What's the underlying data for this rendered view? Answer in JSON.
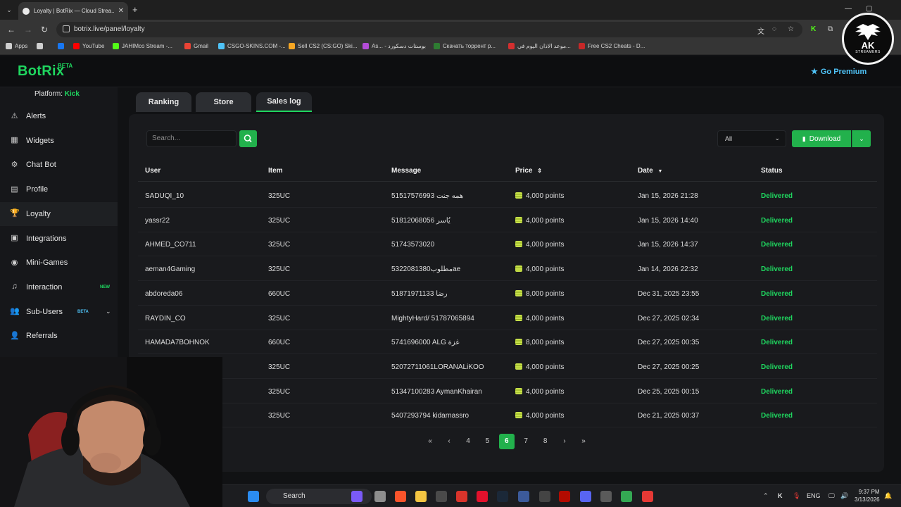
{
  "browser": {
    "tab_title": "Loyalty | BotRix — Cloud Strea...",
    "url": "botrix.live/panel/loyalty",
    "bookmarks": [
      {
        "label": "Apps",
        "color": "#cfcfcf"
      },
      {
        "label": "",
        "color": "#cfcfcf"
      },
      {
        "label": "",
        "color": "#1877f2"
      },
      {
        "label": "YouTube",
        "color": "#ff0000"
      },
      {
        "label": "JAHIMco Stream -...",
        "color": "#53fc18"
      },
      {
        "label": "Gmail",
        "color": "#ea4335"
      },
      {
        "label": "CSGO-SKINS.COM -...",
        "color": "#4fc3f7"
      },
      {
        "label": "Sell CS2 (CS:GO) Ski...",
        "color": "#f5a623"
      },
      {
        "label": "As... - بوستات دسكورد",
        "color": "#b44cd8"
      },
      {
        "label": "Скачать торрент р...",
        "color": "#2e7d32"
      },
      {
        "label": "موعد الاذان اليوم في...",
        "color": "#d32f2f"
      },
      {
        "label": "Free CS2 Cheats - D...",
        "color": "#c62828"
      }
    ]
  },
  "app": {
    "logo": "BotRix",
    "logo_badge": "BETA",
    "premium_label": "Go Premium"
  },
  "badge": {
    "title": "AK",
    "subtitle": "STREAMERS"
  },
  "sidebar": {
    "platform_label": "Platform:",
    "platform_value": "Kick",
    "items": [
      {
        "label": "Alerts",
        "icon": "⚠",
        "tag": "",
        "tag_color": ""
      },
      {
        "label": "Widgets",
        "icon": "▦",
        "tag": "",
        "tag_color": ""
      },
      {
        "label": "Chat Bot",
        "icon": "⚙",
        "tag": "",
        "tag_color": ""
      },
      {
        "label": "Profile",
        "icon": "▤",
        "tag": "",
        "tag_color": ""
      },
      {
        "label": "Loyalty",
        "icon": "🏆",
        "tag": "",
        "tag_color": ""
      },
      {
        "label": "Integrations",
        "icon": "▣",
        "tag": "",
        "tag_color": ""
      },
      {
        "label": "Mini-Games",
        "icon": "◉",
        "tag": "",
        "tag_color": ""
      },
      {
        "label": "Interaction",
        "icon": "♫",
        "tag": "NEW",
        "tag_color": "#1fd65f"
      },
      {
        "label": "Sub-Users",
        "icon": "👥",
        "tag": "BETA",
        "tag_color": "#4fc3f7"
      },
      {
        "label": "Referrals",
        "icon": "👤",
        "tag": "",
        "tag_color": ""
      }
    ]
  },
  "tabs": [
    "Ranking",
    "Store",
    "Sales log"
  ],
  "toolbar": {
    "search_placeholder": "Search...",
    "filter_value": "All",
    "download_label": "Download"
  },
  "table": {
    "columns": [
      "User",
      "Item",
      "Message",
      "Price",
      "Date",
      "Status"
    ],
    "rows": [
      {
        "user": "SADUQI_10",
        "item": "325UC",
        "message": "51517576993 همه جنت",
        "price": "4,000 points",
        "date": "Jan 15, 2026 21:28",
        "status": "Delivered"
      },
      {
        "user": "yassr22",
        "item": "325UC",
        "message": "51812068056 يُاسر",
        "price": "4,000 points",
        "date": "Jan 15, 2026 14:40",
        "status": "Delivered"
      },
      {
        "user": "AHMED_CO711",
        "item": "325UC",
        "message": "51743573020",
        "price": "4,000 points",
        "date": "Jan 15, 2026 14:37",
        "status": "Delivered"
      },
      {
        "user": "aeman4Gaming",
        "item": "325UC",
        "message": "5322081380مطلوبae",
        "price": "4,000 points",
        "date": "Jan 14, 2026 22:32",
        "status": "Delivered"
      },
      {
        "user": "abdoreda06",
        "item": "660UC",
        "message": "51871971133 رضا",
        "price": "8,000 points",
        "date": "Dec 31, 2025 23:55",
        "status": "Delivered"
      },
      {
        "user": "RAYDIN_CO",
        "item": "325UC",
        "message": "MightyHard/ 51787065894",
        "price": "4,000 points",
        "date": "Dec 27, 2025 02:34",
        "status": "Delivered"
      },
      {
        "user": "HAMADA7BOHNOK",
        "item": "660UC",
        "message": "5741696000 ALG غزة",
        "price": "8,000 points",
        "date": "Dec 27, 2025 00:35",
        "status": "Delivered"
      },
      {
        "user": "",
        "item": "325UC",
        "message": "52072711061LORANALiKOO",
        "price": "4,000 points",
        "date": "Dec 27, 2025 00:25",
        "status": "Delivered"
      },
      {
        "user": "",
        "item": "325UC",
        "message": "51347100283 AymanKhairan",
        "price": "4,000 points",
        "date": "Dec 25, 2025 00:15",
        "status": "Delivered"
      },
      {
        "user": "",
        "item": "325UC",
        "message": "5407293794 kidarnassro",
        "price": "4,000 points",
        "date": "Dec 21, 2025 00:37",
        "status": "Delivered"
      }
    ]
  },
  "pagination": {
    "pages": [
      "4",
      "5",
      "6",
      "7",
      "8"
    ],
    "current": "6"
  },
  "taskbar": {
    "search_label": "Search",
    "lang": "ENG",
    "time": "9:37 PM",
    "date": "3/13/2026"
  },
  "colors": {
    "accent": "#1fd65f",
    "button": "#22b14c",
    "premium": "#4fc3f7"
  }
}
